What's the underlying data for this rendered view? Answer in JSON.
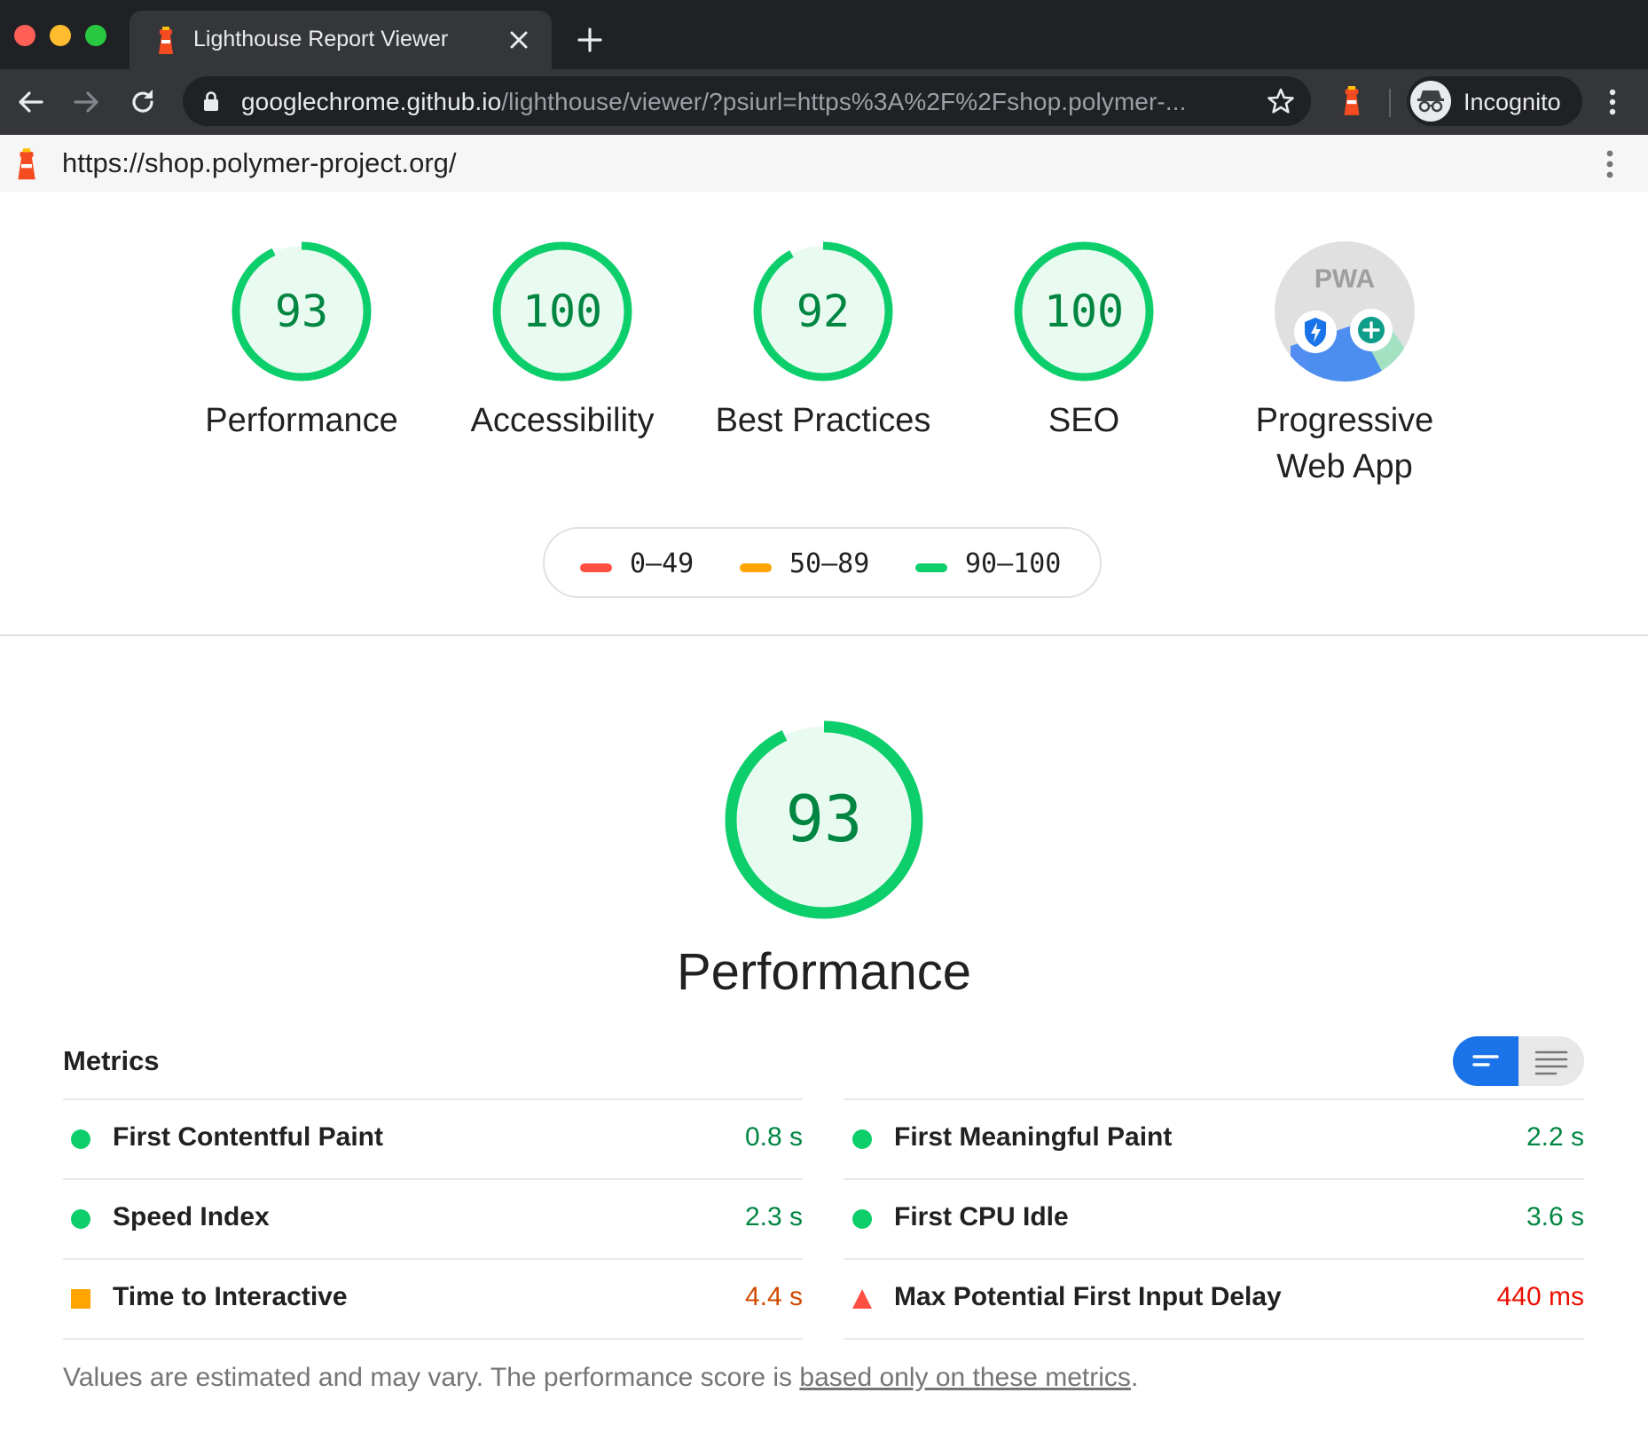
{
  "browser": {
    "tab_title": "Lighthouse Report Viewer",
    "url_host": "googlechrome.github.io",
    "url_rest": "/lighthouse/viewer/?psiurl=https%3A%2F%2Fshop.polymer-...",
    "profile_label": "Incognito"
  },
  "report": {
    "url": "https://shop.polymer-project.org/"
  },
  "gauges": [
    {
      "score": "93",
      "label": "Performance"
    },
    {
      "score": "100",
      "label": "Accessibility"
    },
    {
      "score": "92",
      "label": "Best Practices"
    },
    {
      "score": "100",
      "label": "SEO"
    }
  ],
  "pwa": {
    "badge_text": "PWA",
    "label_line1": "Progressive",
    "label_line2": "Web App"
  },
  "legend": [
    {
      "label": "0–49",
      "color": "#ff4e42"
    },
    {
      "label": "50–89",
      "color": "#ffa400"
    },
    {
      "label": "90–100",
      "color": "#0cce6b"
    }
  ],
  "performance": {
    "score": "93",
    "title": "Performance"
  },
  "metrics": {
    "title": "Metrics",
    "left": [
      {
        "name": "First Contentful Paint",
        "value": "0.8 s",
        "status": "pass"
      },
      {
        "name": "Speed Index",
        "value": "2.3 s",
        "status": "pass"
      },
      {
        "name": "Time to Interactive",
        "value": "4.4 s",
        "status": "average"
      }
    ],
    "right": [
      {
        "name": "First Meaningful Paint",
        "value": "2.2 s",
        "status": "pass"
      },
      {
        "name": "First CPU Idle",
        "value": "3.6 s",
        "status": "pass"
      },
      {
        "name": "Max Potential First Input Delay",
        "value": "440 ms",
        "status": "fail"
      }
    ]
  },
  "footnote": {
    "text": "Values are estimated and may vary. The performance score is ",
    "link": "based only on these metrics",
    "end": "."
  },
  "colors": {
    "pass": "#0cce6b",
    "pass_text": "#018642",
    "average": "#ffa400",
    "average_text": "#d04900",
    "fail": "#ff4e42",
    "fail_text": "#eb0f00",
    "accent": "#1a73e8"
  }
}
